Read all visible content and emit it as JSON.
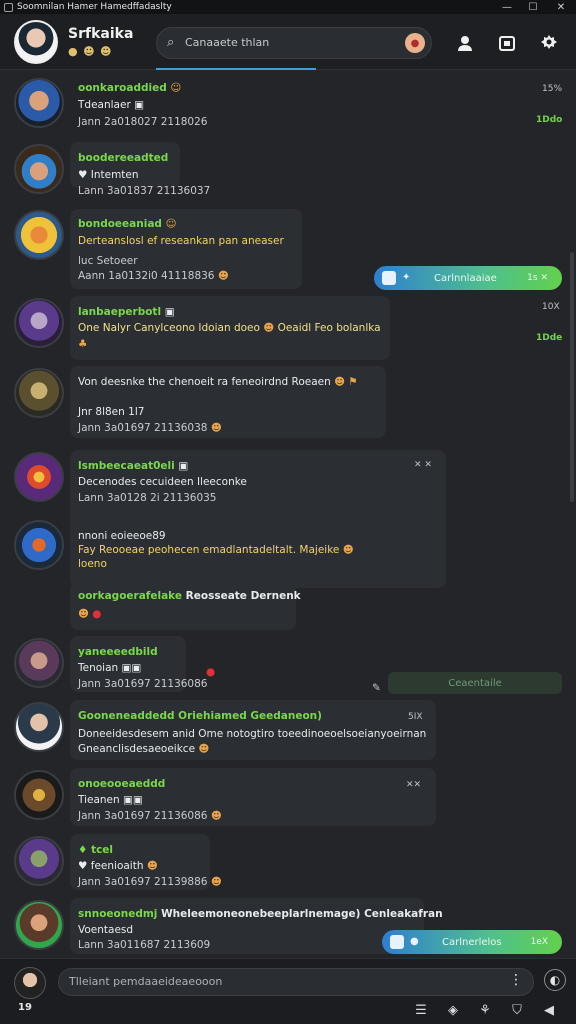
{
  "window": {
    "title": "Soomnilan Hamer Hamedffadaslty",
    "controls": [
      "—",
      "☐",
      "✕"
    ]
  },
  "header": {
    "name": "Srfkaika",
    "badges": "● ☻ ☻",
    "search_text": "Canaaete thlan",
    "icons": [
      "profile-icon",
      "calendar-icon",
      "settings-icon"
    ]
  },
  "messages": [
    {
      "name": "oonkaroaddied",
      "name_emoji": "☺",
      "lines": [
        "Tdeanlaer ▣",
        "Jann  2a018027 2118026"
      ],
      "side": "15%",
      "side_green": "1Ddo"
    },
    {
      "name": "boodereeadted",
      "lines": [
        "♥ Intemten",
        "Lann  3a01837 21136037"
      ]
    },
    {
      "name": "bondoeeaniad",
      "name_emoji": "☺",
      "lines": [
        "Derteanslosl ef reseankan pan aneaser",
        "luc  Setoeer",
        "Aann  1a0132i0 41118836"
      ],
      "line_emoji": "☻"
    },
    {
      "name": "lanbaeperbotl",
      "name_icon": "▣",
      "lines": [
        "One Nalyr Canylceono Idoian doeo",
        "Oeaidl Feo bolanlka"
      ],
      "side": "10X",
      "side_green": "1Dde"
    },
    {
      "name": "Von deesnke the chenoeit ra feneoirdnd Roeaen",
      "lines": [
        "Jnr 8l8en 1l7",
        "Jann  3a01697 21136038"
      ]
    },
    {
      "name": "lsmbeecaeat0eli",
      "name_icon": "▣",
      "lines": [
        "Decenodes cecuideen Ileeconke",
        "Lann  3a0128 2i 21136035"
      ],
      "side": "✕ ✕"
    },
    {
      "name": "nnoni eoieeoe89",
      "lines": [
        "Fay Reooeae peohecen emadlantadeltalt. Majeike",
        "loeno"
      ]
    },
    {
      "name": "oorkagoerafelake",
      "name_tail": "Reosseate Dernenk"
    },
    {
      "name": "yaneeeedbild",
      "lines": [
        "Tenoian ▣▣",
        "Jann  3a01697 21136086"
      ]
    },
    {
      "name": "Gooneneaddedd Oriehiamed Geedaneon)",
      "lines": [
        "Doneeidesdesem anid Ome notogtiro toeedinoeoelsoeianyoeirnan",
        "Gneanclisdesaeoeikce"
      ],
      "side": "5IX"
    },
    {
      "name": "onoeooeaeddd",
      "lines": [
        "Tieanen ▣▣",
        "Jann  3a01697 21136086"
      ],
      "side": "✕✕"
    },
    {
      "name": "♦ tcel",
      "lines": [
        "♥ feenioaith",
        "Jann  3a01697 21139886"
      ]
    },
    {
      "name": "snnoeonedmj",
      "name_tail": "Wheleemoneonebeeplarlnemage) Cenleakafran",
      "lines": [
        "Voentaesd",
        "Lann  3a011687 2113609"
      ]
    }
  ],
  "pills": [
    {
      "label": "Carlnnlaaiae",
      "right": "1s ✕"
    },
    {
      "label": "Carlnerlelos",
      "right": "1eX"
    }
  ],
  "ghost_pill": "Ceaentaile",
  "composer": {
    "placeholder": "Tlleiant pemdaaeideaeooon",
    "count": "19"
  }
}
